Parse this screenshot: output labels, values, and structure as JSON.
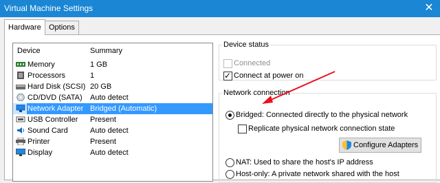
{
  "window": {
    "title": "Virtual Machine Settings",
    "close_label": "✕"
  },
  "tabs": [
    {
      "label": "Hardware",
      "active": true
    },
    {
      "label": "Options",
      "active": false
    }
  ],
  "device_list": {
    "headers": {
      "device": "Device",
      "summary": "Summary"
    },
    "rows": [
      {
        "device": "Memory",
        "summary": "1 GB",
        "icon": "memory-icon"
      },
      {
        "device": "Processors",
        "summary": "1",
        "icon": "processor-icon"
      },
      {
        "device": "Hard Disk (SCSI)",
        "summary": "20 GB",
        "icon": "hard-disk-icon"
      },
      {
        "device": "CD/DVD (SATA)",
        "summary": "Auto detect",
        "icon": "cd-dvd-icon"
      },
      {
        "device": "Network Adapter",
        "summary": "Bridged (Automatic)",
        "icon": "network-adapter-icon",
        "selected": true
      },
      {
        "device": "USB Controller",
        "summary": "Present",
        "icon": "usb-icon"
      },
      {
        "device": "Sound Card",
        "summary": "Auto detect",
        "icon": "speaker-icon"
      },
      {
        "device": "Printer",
        "summary": "Present",
        "icon": "printer-icon"
      },
      {
        "device": "Display",
        "summary": "Auto detect",
        "icon": "display-icon"
      }
    ]
  },
  "device_status": {
    "legend": "Device status",
    "connected": {
      "label": "Connected",
      "checked": false,
      "disabled": true
    },
    "connect_at_power_on": {
      "label": "Connect at power on",
      "checked": true
    }
  },
  "network_connection": {
    "legend": "Network connection",
    "bridged": {
      "label": "Bridged: Connected directly to the physical network",
      "checked": true
    },
    "replicate": {
      "label": "Replicate physical network connection state",
      "checked": false
    },
    "configure_button": "Configure Adapters",
    "nat": {
      "label": "NAT: Used to share the host's IP address",
      "checked": false
    },
    "host_only": {
      "label": "Host-only: A private network shared with the host",
      "checked": false
    }
  },
  "colors": {
    "titlebar": "#1a86d4",
    "selection": "#3399ff",
    "annotation_arrow": "#e81123"
  }
}
